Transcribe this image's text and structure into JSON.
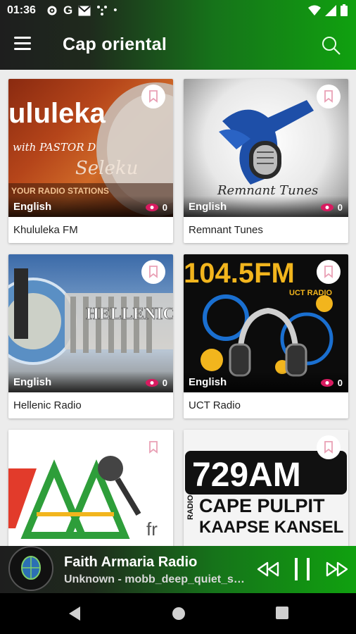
{
  "status": {
    "time": "01:36",
    "left_icons": [
      "gear-icon",
      "google-icon",
      "mail-icon",
      "network-icon",
      "dot-icon"
    ],
    "right_icons": [
      "wifi-icon",
      "signal-icon",
      "battery-icon"
    ]
  },
  "appbar": {
    "title": "Cap oriental",
    "menu_icon": "hamburger-menu-icon",
    "search_icon": "search-icon"
  },
  "colors": {
    "bar_dark": "#1e1e1e",
    "bar_green": "#10a10f",
    "accent_pink": "#d81b60",
    "background": "#ececec"
  },
  "stations": [
    {
      "name": "Khululeka FM",
      "language": "English",
      "views": "0",
      "art_text": [
        "ululeka",
        "with PASTOR D",
        "Seleku",
        "YOUR RADIO STATIONS"
      ]
    },
    {
      "name": "Remnant Tunes",
      "language": "English",
      "views": "0",
      "art_text": [
        "Remnant Tunes"
      ]
    },
    {
      "name": "Hellenic Radio",
      "language": "English",
      "views": "0",
      "art_text": [
        "HELLENIC R"
      ]
    },
    {
      "name": "UCT Radio",
      "language": "English",
      "views": "0",
      "art_text": [
        "104.5FM",
        "UCT RADIO"
      ]
    },
    {
      "name": "",
      "language": "",
      "views": "",
      "art_text": [
        "fr"
      ]
    },
    {
      "name": "",
      "language": "",
      "views": "",
      "art_text": [
        "729AM",
        "CAPE PULPIT",
        "KAAPSE KANSEL",
        "RADIO"
      ]
    }
  ],
  "player": {
    "station": "Faith Armaria Radio",
    "track": "Unknown - mobb_deep_quiet_storm",
    "controls": [
      "rewind-icon",
      "pause-icon",
      "fast-forward-icon"
    ]
  },
  "navbar": [
    "back-icon",
    "home-icon",
    "recents-icon"
  ]
}
